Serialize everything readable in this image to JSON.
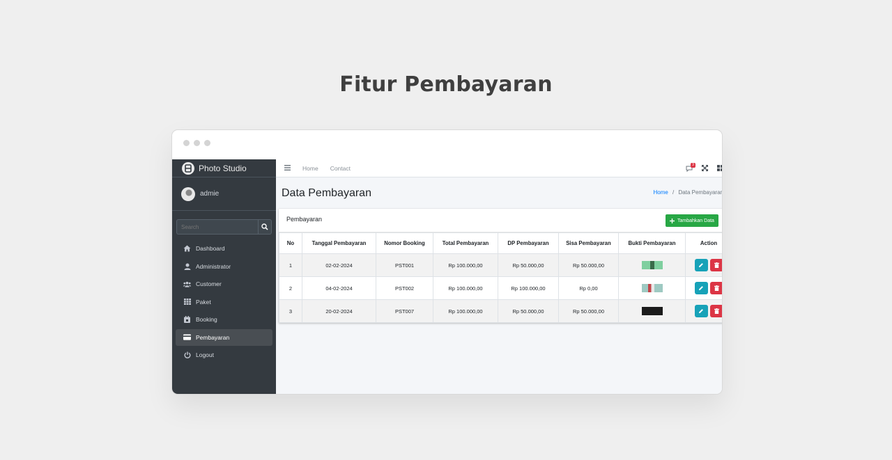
{
  "page": {
    "heading": "Fitur Pembayaran"
  },
  "sidebar": {
    "brand": "Photo Studio",
    "user": "admie",
    "search_placeholder": "Search",
    "items": [
      {
        "label": "Dashboard",
        "icon": "home-icon"
      },
      {
        "label": "Administrator",
        "icon": "user-icon"
      },
      {
        "label": "Customer",
        "icon": "users-icon"
      },
      {
        "label": "Paket",
        "icon": "grid-icon"
      },
      {
        "label": "Booking",
        "icon": "calendar-icon"
      },
      {
        "label": "Pembayaran",
        "icon": "credit-card-icon",
        "active": true
      },
      {
        "label": "Logout",
        "icon": "power-icon"
      }
    ]
  },
  "topbar": {
    "links": [
      "Home",
      "Contact"
    ],
    "notif_count": "3"
  },
  "content": {
    "title": "Data Pembayaran",
    "breadcrumb_home": "Home",
    "breadcrumb_sep": "/",
    "breadcrumb_current": "Data Pembayaran",
    "card_title": "Pembayaran",
    "add_button": "Tambahkan Data"
  },
  "table": {
    "headers": [
      "No",
      "Tanggal Pembayaran",
      "Nomor Booking",
      "Total Pembayaran",
      "DP Pembayaran",
      "Sisa Pembayaran",
      "Bukti Pembayaran",
      "Action"
    ],
    "rows": [
      {
        "no": "1",
        "date": "02-02-2024",
        "booking": "PST001",
        "total": "Rp 100.000,00",
        "dp": "Rp 50.000,00",
        "sisa": "Rp 50.000,00",
        "proof_color": "#7fcf9f"
      },
      {
        "no": "2",
        "date": "04-02-2024",
        "booking": "PST002",
        "total": "Rp 100.000,00",
        "dp": "Rp 100.000,00",
        "sisa": "Rp 0,00",
        "proof_color": "#9ec9c2"
      },
      {
        "no": "3",
        "date": "20-02-2024",
        "booking": "PST007",
        "total": "Rp 100.000,00",
        "dp": "Rp 50.000,00",
        "sisa": "Rp 50.000,00",
        "proof_color": "#1c1c1c"
      }
    ]
  },
  "colors": {
    "sidebar_bg": "#343a40",
    "accent_green": "#28a745",
    "edit": "#17a2b8",
    "delete": "#dc3545",
    "link": "#007bff"
  }
}
